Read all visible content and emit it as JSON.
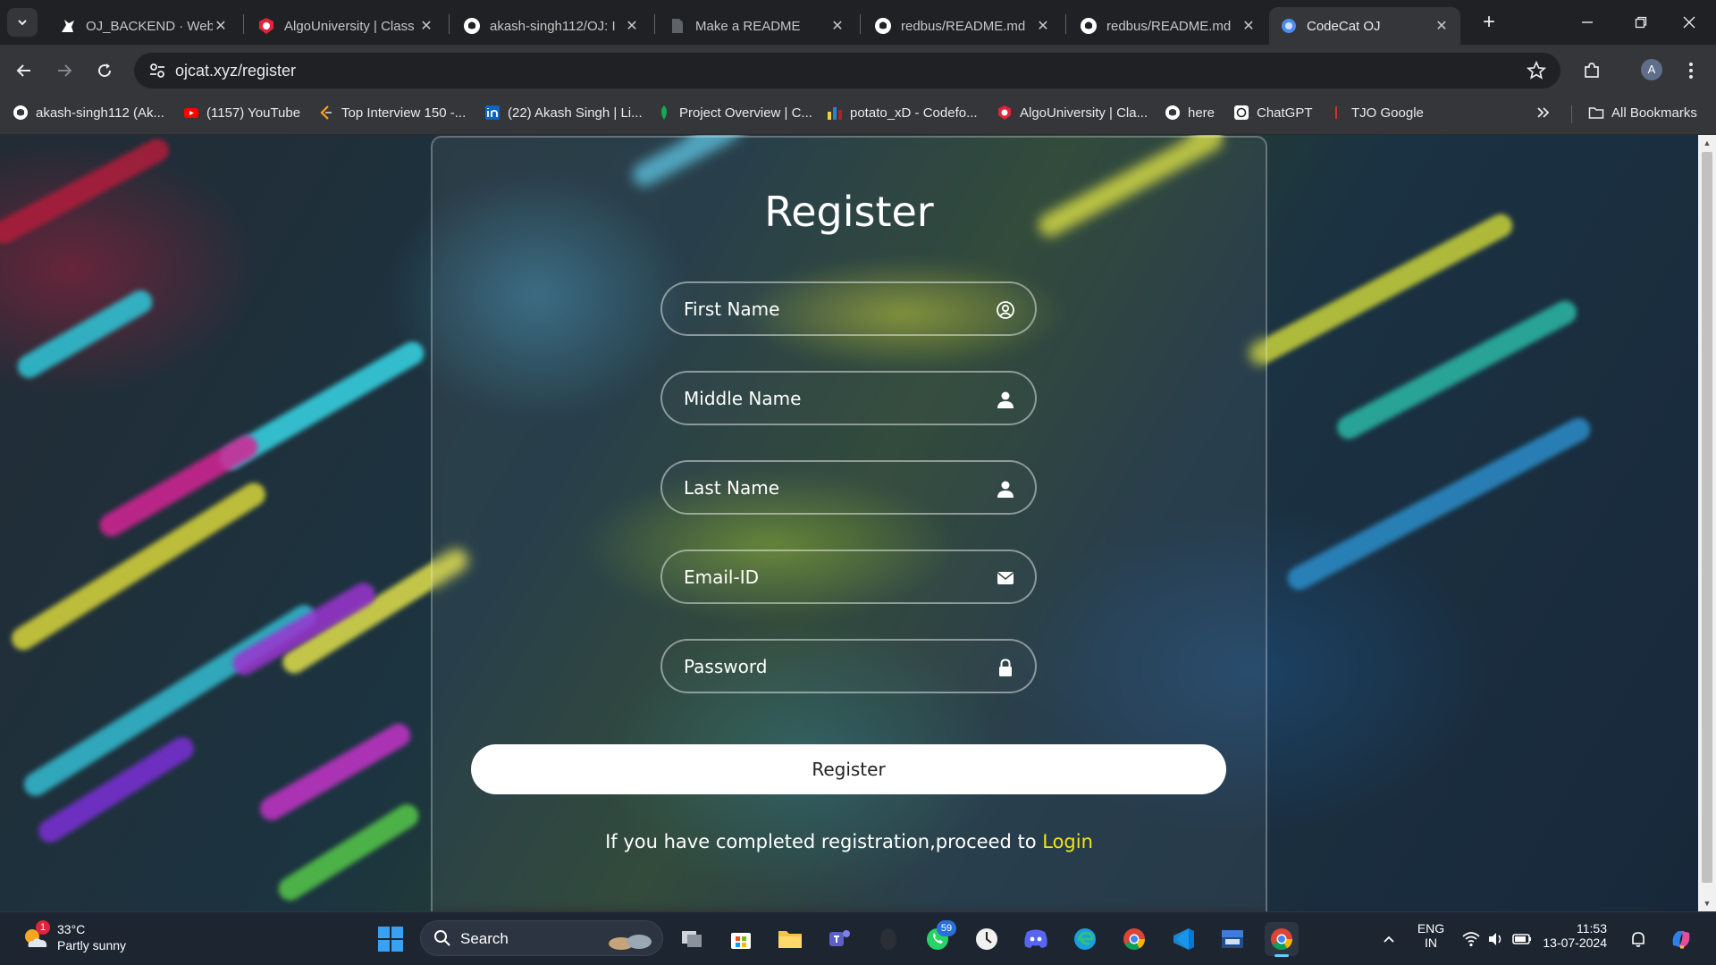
{
  "browser": {
    "tabs": [
      {
        "title": "OJ_BACKEND · Web",
        "icon": "cat-silhouette-icon"
      },
      {
        "title": "AlgoUniversity | Class",
        "icon": "algouniversity-icon"
      },
      {
        "title": "akash-singh112/OJ: I",
        "icon": "github-icon"
      },
      {
        "title": "Make a README",
        "icon": "document-icon"
      },
      {
        "title": "redbus/README.md",
        "icon": "github-icon"
      },
      {
        "title": "redbus/README.md",
        "icon": "github-icon"
      },
      {
        "title": "CodeCat OJ",
        "icon": "codecat-icon",
        "active": true
      }
    ],
    "address": "ojcat.xyz/register",
    "avatar_initial": "A",
    "bookmarks": [
      {
        "label": "akash-singh112 (Ak...",
        "icon": "github-icon"
      },
      {
        "label": "(1157) YouTube",
        "icon": "youtube-icon"
      },
      {
        "label": "Top Interview 150 -...",
        "icon": "leetcode-icon"
      },
      {
        "label": "(22) Akash Singh | Li...",
        "icon": "linkedin-icon"
      },
      {
        "label": "Project Overview | C...",
        "icon": "mongodb-leaf-icon"
      },
      {
        "label": "potato_xD - Codefo...",
        "icon": "codeforces-icon"
      },
      {
        "label": "AlgoUniversity | Cla...",
        "icon": "algouniversity-icon"
      },
      {
        "label": "here",
        "icon": "github-icon"
      },
      {
        "label": "ChatGPT",
        "icon": "chatgpt-icon"
      },
      {
        "label": "TJO Google",
        "icon": "pin-icon"
      }
    ],
    "all_bookmarks_label": "All Bookmarks"
  },
  "page": {
    "title": "Register",
    "fields": {
      "first_name": "First Name",
      "middle_name": "Middle Name",
      "last_name": "Last Name",
      "email": "Email-ID",
      "password": "Password"
    },
    "register_button": "Register",
    "footer_text": "If you have completed registration,proceed to ",
    "login_link": "Login"
  },
  "taskbar": {
    "weather_temp": "33°C",
    "weather_desc": "Partly sunny",
    "weather_badge": "1",
    "search_label": "Search",
    "whatsapp_badge": "59",
    "lang_top": "ENG",
    "lang_bottom": "IN",
    "time": "11:53",
    "date": "13-07-2024"
  },
  "colors": {
    "login_link": "#f2e21a",
    "browser_frame": "#35363a",
    "tabstrip": "#202124"
  }
}
